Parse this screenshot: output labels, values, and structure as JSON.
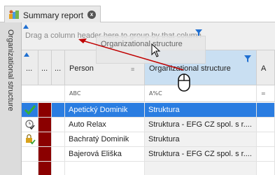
{
  "tab": {
    "title": "Summary report",
    "close_glyph": "x",
    "icon": "summary-report-icon"
  },
  "side_panel": {
    "label": "Organizational structure"
  },
  "group_panel": {
    "hint": "Drag a column header here to group by that column"
  },
  "drag_ghost": {
    "label": "Organizational structure"
  },
  "columns": [
    {
      "label": "..."
    },
    {
      "label": "..."
    },
    {
      "label": "..."
    },
    {
      "label": "Person"
    },
    {
      "label": "Organizational structure"
    },
    {
      "label": "A"
    }
  ],
  "filter_row": {
    "person": "ABC",
    "org": "A%C",
    "last": "="
  },
  "rows": [
    {
      "status_icon": "green-check-icon",
      "person": "Apetický Dominik",
      "org": "Struktura",
      "selected": true
    },
    {
      "status_icon": "clock-check-icon",
      "person": "Auto Relax",
      "org": "Struktura - EFG CZ spol. s r....",
      "selected": false
    },
    {
      "status_icon": "lock-check-icon",
      "person": "Bachratý Dominik",
      "org": "Struktura",
      "selected": false
    },
    {
      "status_icon": "",
      "person": "Bajerová Eliška",
      "org": "Struktura - EFG CZ spol. s r....",
      "selected": false
    }
  ],
  "colors": {
    "selected": "#2a7de1",
    "dark_cell": "#8b0000",
    "accent": "#1f6fd1",
    "arrow": "#c00000"
  }
}
